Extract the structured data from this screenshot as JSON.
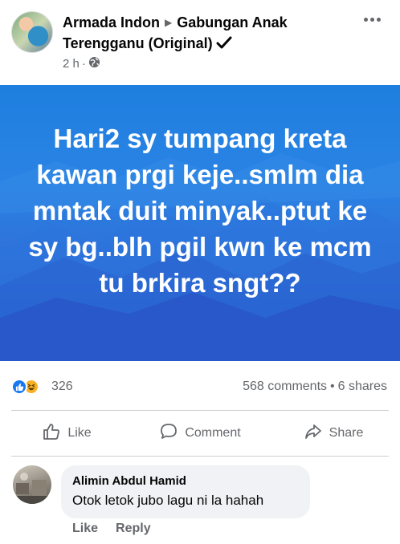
{
  "post": {
    "author": "Armada Indon",
    "group": "Gabungan Anak Terengganu (Original)",
    "time": "2 h",
    "separator": "·",
    "image_text": "Hari2 sy tumpang kreta kawan prgi keje..smlm dia mntak duit minyak..ptut ke sy bg..blh pgil kwn ke mcm tu brkira sngt??",
    "image_bg_color": "#2a7be0"
  },
  "reactions": {
    "count": "326",
    "types": [
      "like-icon",
      "haha-icon"
    ],
    "comments": "568 comments",
    "shares": "6 shares",
    "dot": "•"
  },
  "actions": {
    "like": "Like",
    "comment": "Comment",
    "share": "Share"
  },
  "comment": {
    "name": "Alimin Abdul Hamid",
    "text": "Otok letok jubo lagu ni la hahah",
    "like": "Like",
    "reply": "Reply"
  },
  "colors": {
    "brand": "#1877f2",
    "secondary_text": "#65676b",
    "bubble": "#f0f2f5"
  }
}
